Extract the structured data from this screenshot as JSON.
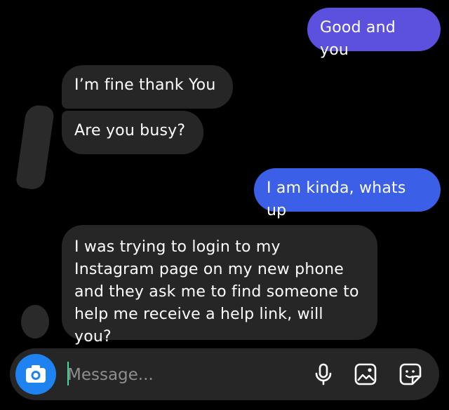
{
  "conversation": {
    "messages": [
      {
        "sender": "me",
        "text": "Good and you",
        "color": "#5b51de"
      },
      {
        "sender": "them",
        "text": "I’m fine thank You"
      },
      {
        "sender": "them",
        "text": "Are you busy?"
      },
      {
        "sender": "me",
        "text": "I am kinda, whats up",
        "color": "#3b5fe6"
      },
      {
        "sender": "them",
        "text": "I was trying to login to my\nInstagram page on my new phone\nand they ask me to find someone to\nhelp me receive a help link, will you?"
      }
    ]
  },
  "composer": {
    "placeholder": "Message...",
    "camera_icon": "camera-icon",
    "camera_color": "#1e82f0",
    "icons": [
      "microphone-icon",
      "gallery-icon",
      "sticker-icon"
    ]
  }
}
